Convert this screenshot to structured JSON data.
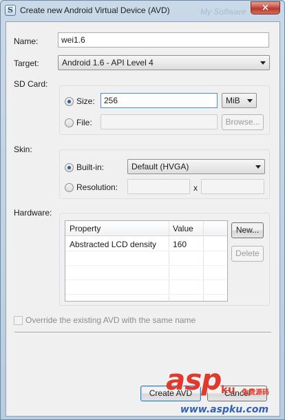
{
  "window": {
    "title": "Create new Android Virtual Device (AVD)",
    "ghost_title": "My Software",
    "close_glyph": "×"
  },
  "form": {
    "name_label": "Name:",
    "name_value": "wei1.6",
    "target_label": "Target:",
    "target_value": "Android 1.6 - API Level 4",
    "sdcard_label": "SD Card:",
    "size_label": "Size:",
    "size_value": "256",
    "size_unit": "MiB",
    "file_label": "File:",
    "browse_label": "Browse...",
    "skin_label": "Skin:",
    "builtin_label": "Built-in:",
    "builtin_value": "Default (HVGA)",
    "resolution_label": "Resolution:",
    "resolution_x": "x",
    "hardware_label": "Hardware:",
    "override_label": "Override the existing AVD with the same name"
  },
  "hardware_table": {
    "columns": [
      "Property",
      "Value"
    ],
    "rows": [
      {
        "property": "Abstracted LCD density",
        "value": "160"
      }
    ]
  },
  "buttons": {
    "new": "New...",
    "delete": "Delete",
    "create": "Create AVD",
    "cancel": "Cancel"
  },
  "watermark": {
    "main": "asp",
    "sub": "ku",
    "sub_cn": "免费源码",
    "url": "www.aspku.com"
  }
}
